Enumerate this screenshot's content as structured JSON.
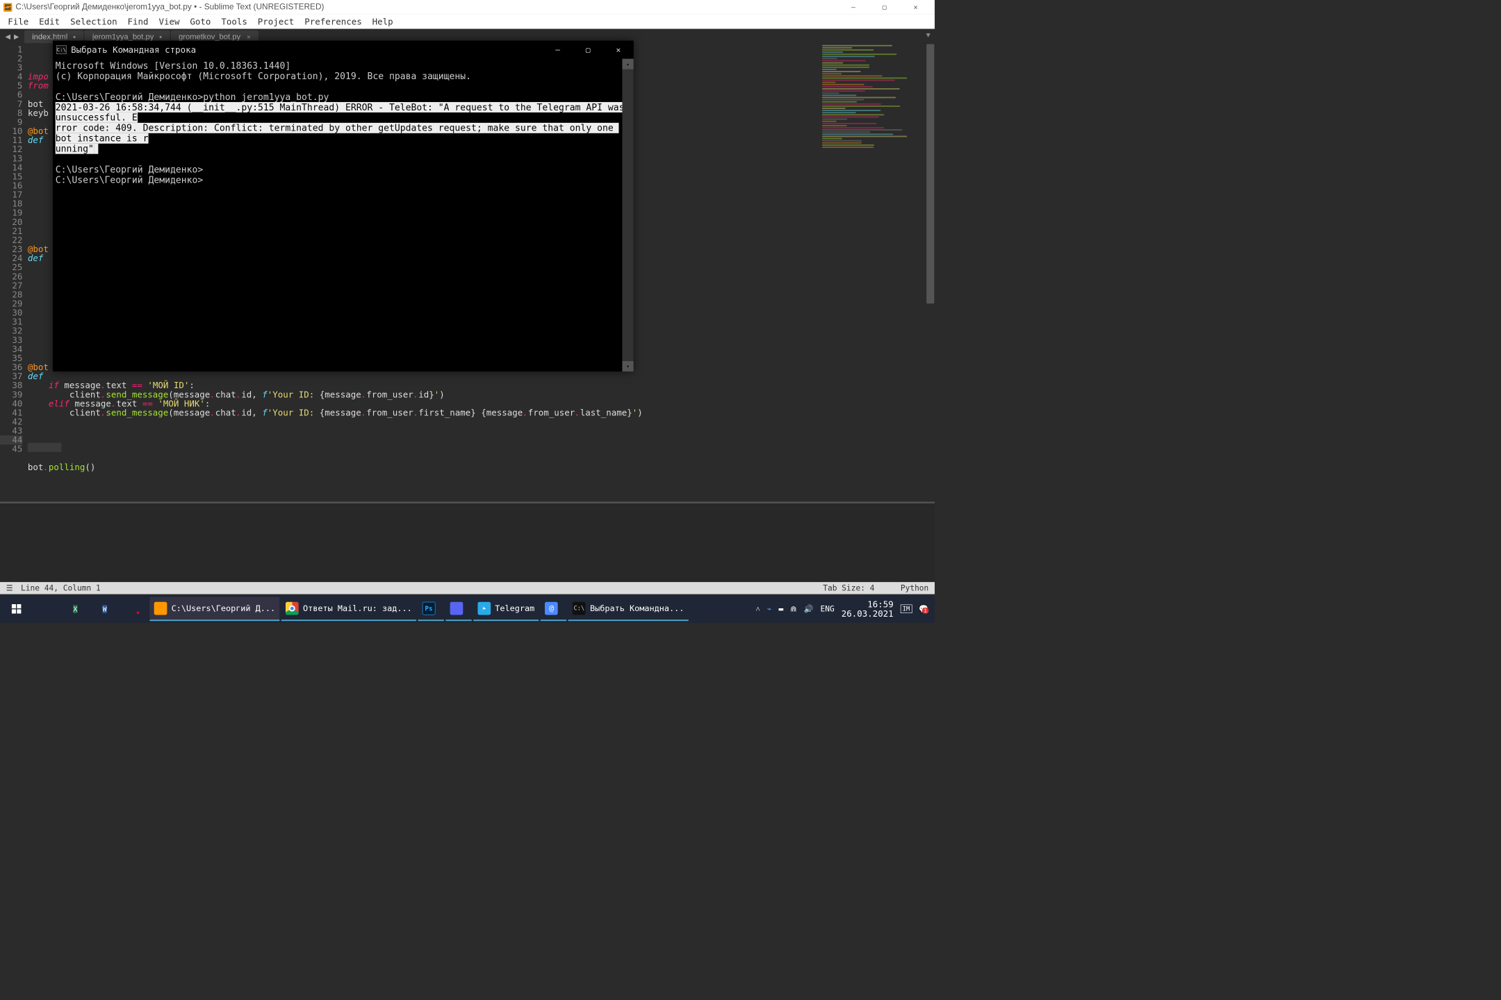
{
  "app": {
    "title": "C:\\Users\\Георгий Демиденко\\jerom1yya_bot.py • - Sublime Text (UNREGISTERED)"
  },
  "menu": [
    "File",
    "Edit",
    "Selection",
    "Find",
    "View",
    "Goto",
    "Tools",
    "Project",
    "Preferences",
    "Help"
  ],
  "tabs": [
    {
      "label": "index.html",
      "dirty": true
    },
    {
      "label": "jerom1yya_bot.py",
      "dirty": true
    },
    {
      "label": "grometkov_bot.py",
      "dirty": false
    }
  ],
  "gutter_lines": 45,
  "code_lines": [
    [
      [
        "k-red",
        "impo"
      ]
    ],
    [
      [
        "k-red",
        "from"
      ]
    ],
    [
      [
        ""
      ]
    ],
    [
      [
        "",
        "bot "
      ]
    ],
    [
      [
        "",
        "keyb"
      ]
    ],
    [
      [
        ""
      ]
    ],
    [
      [
        "k-orange",
        "@bot"
      ]
    ],
    [
      [
        "k-blue",
        "def"
      ]
    ],
    [
      [
        ""
      ]
    ],
    [
      [
        ""
      ]
    ],
    [
      [
        ""
      ]
    ],
    [
      [
        ""
      ]
    ],
    [
      [
        ""
      ]
    ],
    [
      [
        ""
      ]
    ],
    [
      [
        ""
      ]
    ],
    [
      [
        ""
      ]
    ],
    [
      [
        ""
      ]
    ],
    [
      [
        ""
      ]
    ],
    [
      [
        ""
      ]
    ],
    [
      [
        "k-orange",
        "@bot"
      ]
    ],
    [
      [
        "k-blue",
        "def"
      ]
    ],
    [
      [
        ""
      ]
    ],
    [
      [
        ""
      ]
    ],
    [
      [
        ""
      ]
    ],
    [
      [
        ""
      ]
    ],
    [
      [
        ""
      ]
    ],
    [
      [
        ""
      ]
    ],
    [
      [
        ""
      ]
    ],
    [
      [
        ""
      ]
    ],
    [
      [
        ""
      ]
    ],
    [
      [
        ""
      ]
    ],
    [
      [
        ""
      ]
    ],
    [
      [
        "k-orange",
        "@bot"
      ]
    ],
    [
      [
        "k-blue",
        "def"
      ]
    ],
    [
      [
        "",
        "    "
      ],
      [
        "k-red",
        "if"
      ],
      [
        "",
        " message"
      ],
      [
        "k-red",
        "."
      ],
      [
        "",
        "text "
      ],
      [
        "k-red",
        "=="
      ],
      [
        "",
        " "
      ],
      [
        "k-yellow",
        "'МОЙ ID'"
      ],
      [
        "",
        ":"
      ]
    ],
    [
      [
        "",
        "        client"
      ],
      [
        "k-red",
        "."
      ],
      [
        "k-green",
        "send_message"
      ],
      [
        "",
        "("
      ],
      [
        "",
        "message"
      ],
      [
        "k-red",
        "."
      ],
      [
        "",
        "chat"
      ],
      [
        "k-red",
        "."
      ],
      [
        "",
        "id"
      ],
      [
        "",
        ", "
      ],
      [
        "k-blue",
        "f"
      ],
      [
        "k-yellow",
        "'Your ID: "
      ],
      [
        "",
        "{message"
      ],
      [
        "k-red",
        "."
      ],
      [
        "",
        "from_user"
      ],
      [
        "k-red",
        "."
      ],
      [
        "",
        "id}"
      ],
      [
        "k-yellow",
        "'"
      ],
      [
        "",
        ")"
      ]
    ],
    [
      [
        "",
        "    "
      ],
      [
        "k-red",
        "elif"
      ],
      [
        "",
        " message"
      ],
      [
        "k-red",
        "."
      ],
      [
        "",
        "text "
      ],
      [
        "k-red",
        "=="
      ],
      [
        "",
        " "
      ],
      [
        "k-yellow",
        "'МОЙ НИК'"
      ],
      [
        "",
        ":"
      ]
    ],
    [
      [
        "",
        "        client"
      ],
      [
        "k-red",
        "."
      ],
      [
        "k-green",
        "send_message"
      ],
      [
        "",
        "("
      ],
      [
        "",
        "message"
      ],
      [
        "k-red",
        "."
      ],
      [
        "",
        "chat"
      ],
      [
        "k-red",
        "."
      ],
      [
        "",
        "id"
      ],
      [
        "",
        ", "
      ],
      [
        "k-blue",
        "f"
      ],
      [
        "k-yellow",
        "'Your ID: "
      ],
      [
        "",
        "{message"
      ],
      [
        "k-red",
        "."
      ],
      [
        "",
        "from_user"
      ],
      [
        "k-red",
        "."
      ],
      [
        "",
        "first_name} {message"
      ],
      [
        "k-red",
        "."
      ],
      [
        "",
        "from_user"
      ],
      [
        "k-red",
        "."
      ],
      [
        "",
        "last_name}"
      ],
      [
        "k-yellow",
        "'"
      ],
      [
        "",
        ")"
      ]
    ],
    [
      [
        ""
      ]
    ],
    [
      [
        ""
      ]
    ],
    [
      [
        ""
      ]
    ],
    [
      [
        ""
      ]
    ],
    [
      [
        ""
      ]
    ],
    [
      [
        "",
        "bot"
      ],
      [
        "k-red",
        "."
      ],
      [
        "k-green",
        "polling"
      ],
      [
        "",
        "()"
      ]
    ]
  ],
  "status": {
    "line_col": "Line 44, Column 1",
    "tab_size": "Tab Size: 4",
    "syntax": "Python"
  },
  "cmd": {
    "title": "Выбрать Командная строка",
    "line1": "Microsoft Windows [Version 10.0.18363.1440]",
    "line2": "(c) Корпорация Майкрософт (Microsoft Corporation), 2019. Все права защищены.",
    "prompt": "C:\\Users\\Георгий Демиденко>",
    "command": "python jerom1yya_bot.py",
    "err1": "2021-03-26 16:58:34,744 (__init__.py:515 MainThread) ERROR - TeleBot: \"A request to the Telegram API was unsuccessful. E",
    "err2": "rror code: 409. Description: Conflict: terminated by other getUpdates request; make sure that only one bot instance is r",
    "err3": "unning\""
  },
  "taskbar": {
    "apps": [
      {
        "ico": "ic-sublime",
        "label": "C:\\Users\\Георгий Д...",
        "state": "active"
      },
      {
        "ico": "ic-chrome",
        "label": "Ответы Mail.ru: зад...",
        "state": "running"
      },
      {
        "ico": "ic-ps",
        "label": "",
        "state": "running",
        "text": "Ps"
      },
      {
        "ico": "ic-discord",
        "label": "",
        "state": "running"
      },
      {
        "ico": "ic-telegram",
        "label": "Telegram",
        "state": "running"
      },
      {
        "ico": "ic-mail",
        "label": "",
        "state": "running"
      },
      {
        "ico": "ic-cmd",
        "label": "Выбрать Командна...",
        "state": "running",
        "text": "C:\\"
      }
    ],
    "tray": {
      "lang": "ENG",
      "time": "16:59",
      "date": "26.03.2021",
      "notif": "1"
    }
  }
}
